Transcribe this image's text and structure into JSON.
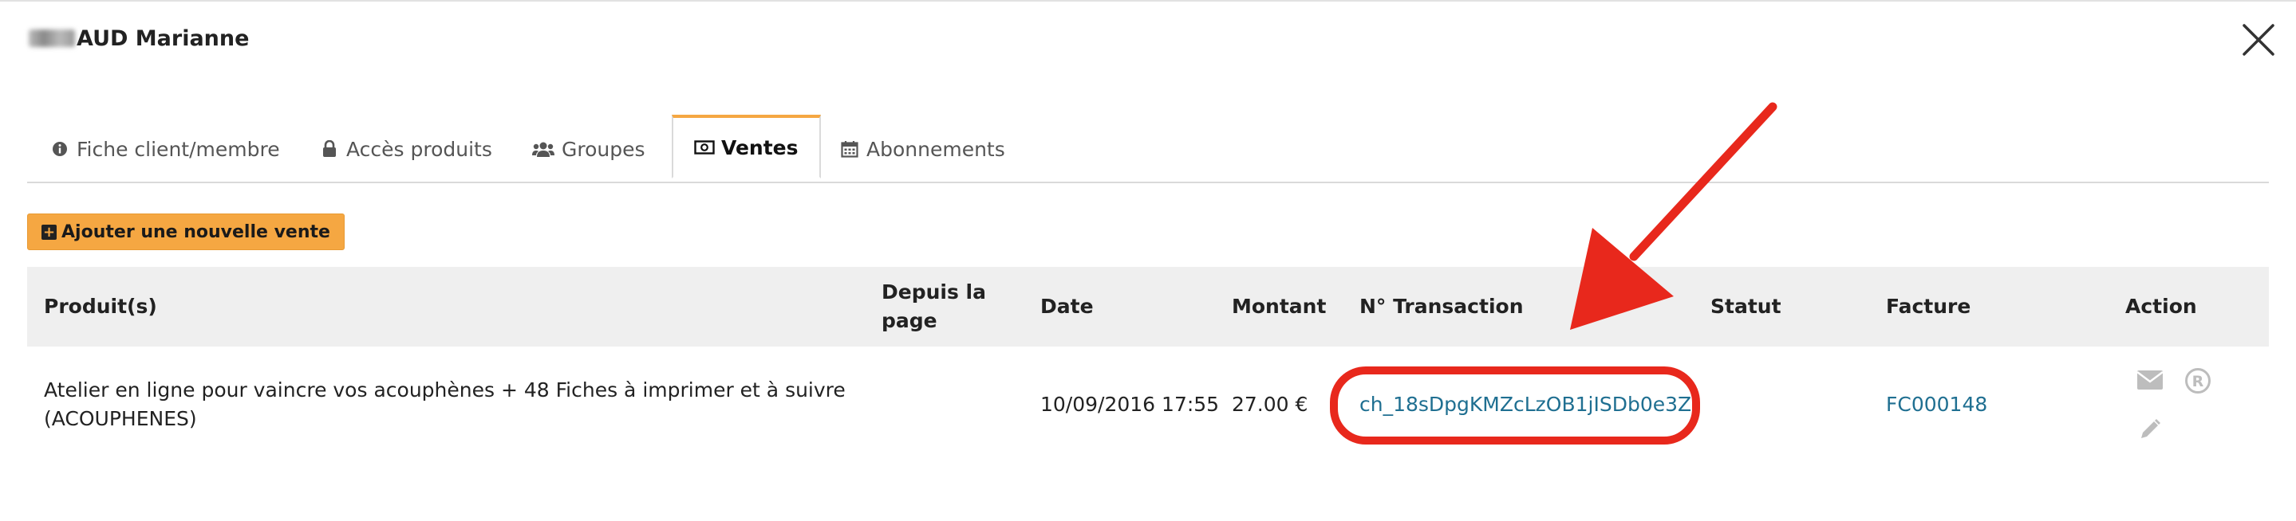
{
  "modal": {
    "title_suffix": "AUD Marianne"
  },
  "tabs": [
    {
      "label": "Fiche client/membre",
      "icon": "info-circle-icon"
    },
    {
      "label": "Accès produits",
      "icon": "lock-icon"
    },
    {
      "label": "Groupes",
      "icon": "users-icon"
    },
    {
      "label": "Ventes",
      "icon": "money-icon"
    },
    {
      "label": "Abonnements",
      "icon": "calendar-icon"
    }
  ],
  "active_tab": "Ventes",
  "toolbar": {
    "add_sale_label": "Ajouter une nouvelle vente"
  },
  "table": {
    "headers": [
      "Produit(s)",
      "Depuis la page",
      "Date",
      "Montant",
      "N° Transaction",
      "Statut",
      "Facture",
      "Action"
    ],
    "rows": [
      {
        "product": "Atelier en ligne pour vaincre vos acouphènes + 48 Fiches à imprimer et à suivre (ACOUPHENES)",
        "source_page": "",
        "date": "10/09/2016 17:55",
        "amount": "27.00 €",
        "transaction": "ch_18sDpgKMZcLzOB1jISDb0e3Z",
        "status": "",
        "invoice": "FC000148",
        "actions": [
          "envelope-icon",
          "registered-icon",
          "pencil-icon"
        ]
      }
    ]
  },
  "colors": {
    "accent_orange": "#f5a742",
    "link": "#1f6f91",
    "annotation_red": "#e8281c",
    "header_bg": "#efefef"
  }
}
